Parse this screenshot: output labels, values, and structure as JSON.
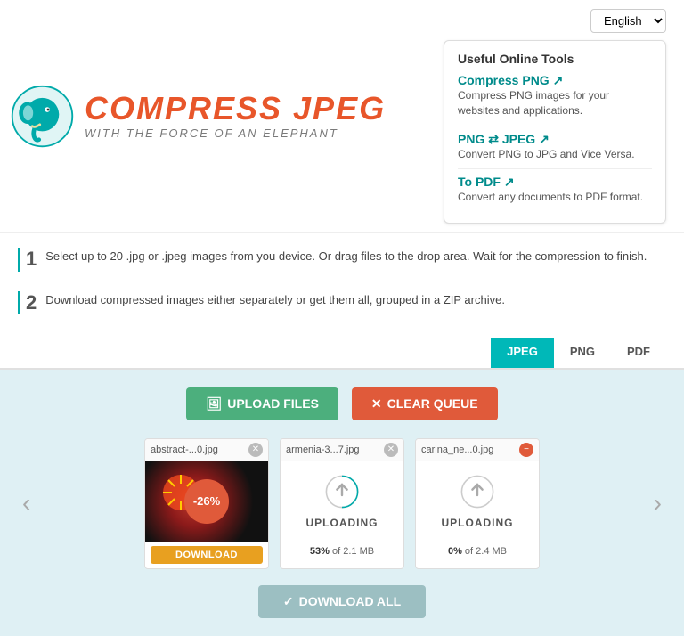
{
  "header": {
    "logo_title": "COMPRESS JPEG",
    "logo_subtitle": "WITH THE FORCE OF AN ELEPHANT",
    "lang_label": "English"
  },
  "tools_panel": {
    "title": "Useful Online Tools",
    "tool1": {
      "link": "Compress PNG ↗",
      "desc": "Compress PNG images for your websites and applications."
    },
    "tool2": {
      "link": "PNG ⇄ JPEG ↗",
      "desc": "Convert PNG to JPG and Vice Versa."
    },
    "tool3": {
      "link": "To PDF ↗",
      "desc": "Convert any documents to PDF format."
    }
  },
  "steps": [
    {
      "number": "1",
      "text": "Select up to 20 .jpg or .jpeg images from you device. Or drag files to the drop area. Wait for the compression to finish."
    },
    {
      "number": "2",
      "text": "Download compressed images either separately or get them all, grouped in a ZIP archive."
    }
  ],
  "tabs": [
    {
      "label": "JPEG",
      "active": true
    },
    {
      "label": "PNG",
      "active": false
    },
    {
      "label": "PDF",
      "active": false
    }
  ],
  "buttons": {
    "upload": "UPLOAD FILES",
    "clear": "CLEAR QUEUE",
    "download_all": "DOWNLOAD ALL"
  },
  "files": [
    {
      "name": "abstract-...0.jpg",
      "status": "done",
      "badge": "-26%",
      "footer_type": "download",
      "footer_text": "DOWNLOAD"
    },
    {
      "name": "armenia-3...7.jpg",
      "status": "uploading",
      "progress": "53% of 2.1 MB",
      "progress_bold": "53%",
      "footer_type": "progress"
    },
    {
      "name": "carina_ne...0.jpg",
      "status": "uploading",
      "progress": "0% of 2.4 MB",
      "progress_bold": "0%",
      "footer_type": "progress"
    }
  ],
  "nav": {
    "prev": "‹",
    "next": "›"
  },
  "colors": {
    "teal": "#00b8b8",
    "orange": "#e8562a",
    "green": "#4caf7d",
    "red_btn": "#e05a3a"
  }
}
